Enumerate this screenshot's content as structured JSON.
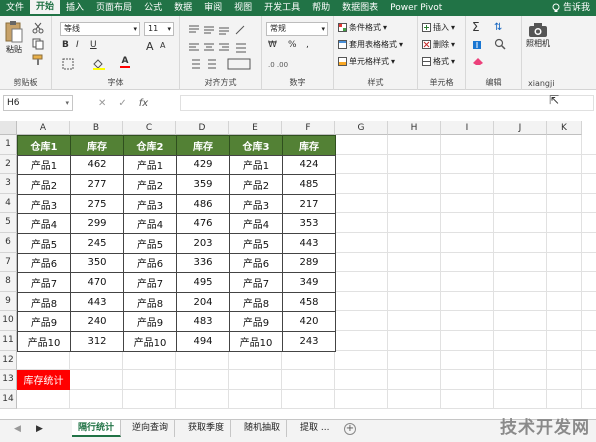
{
  "tabs": [
    "文件",
    "开始",
    "插入",
    "页面布局",
    "公式",
    "数据",
    "审阅",
    "视图",
    "开发工具",
    "帮助",
    "数据图表",
    "Power Pivot"
  ],
  "active_tab": "开始",
  "tell_me": "告诉我",
  "ribbon": {
    "clipboard": {
      "paste": "粘贴",
      "label": "剪贴板"
    },
    "font": {
      "name": "等线",
      "size": "11",
      "label": "字体",
      "bold": "B",
      "italic": "I",
      "underline": "U",
      "grow": "A",
      "shrink": "A",
      "color_glyph": "A"
    },
    "align": {
      "label": "对齐方式"
    },
    "number": {
      "format": "常规",
      "label": "数字",
      "percent": "%",
      "comma": ",",
      "currency": "₩"
    },
    "styles": {
      "cond": "条件格式",
      "table": "套用表格格式",
      "cell": "单元格样式",
      "label": "样式"
    },
    "cells": {
      "insert": "插入",
      "delete": "删除",
      "format": "格式",
      "label": "单元格"
    },
    "edit": {
      "label": "编辑"
    },
    "camera": {
      "label": "照相机",
      "group": "xiangji"
    }
  },
  "formula_bar": {
    "name_box": "H6",
    "cancel": "✕",
    "enter": "✓",
    "fx": "fx",
    "content": ""
  },
  "columns": [
    "A",
    "B",
    "C",
    "D",
    "E",
    "F",
    "G",
    "H",
    "I",
    "J",
    "K"
  ],
  "rows": [
    "1",
    "2",
    "3",
    "4",
    "5",
    "6",
    "7",
    "8",
    "9",
    "10",
    "11",
    "12",
    "13",
    "14"
  ],
  "table": {
    "headers": [
      "仓库1",
      "库存",
      "仓库2",
      "库存",
      "仓库3",
      "库存"
    ],
    "rows": [
      [
        "产品1",
        "462",
        "产品1",
        "429",
        "产品1",
        "424"
      ],
      [
        "产品2",
        "277",
        "产品2",
        "359",
        "产品2",
        "485"
      ],
      [
        "产品3",
        "275",
        "产品3",
        "486",
        "产品3",
        "217"
      ],
      [
        "产品4",
        "299",
        "产品4",
        "476",
        "产品4",
        "353"
      ],
      [
        "产品5",
        "245",
        "产品5",
        "203",
        "产品5",
        "443"
      ],
      [
        "产品6",
        "350",
        "产品6",
        "336",
        "产品6",
        "289"
      ],
      [
        "产品7",
        "470",
        "产品7",
        "495",
        "产品7",
        "349"
      ],
      [
        "产品8",
        "443",
        "产品8",
        "204",
        "产品8",
        "458"
      ],
      [
        "产品9",
        "240",
        "产品9",
        "483",
        "产品9",
        "420"
      ],
      [
        "产品10",
        "312",
        "产品10",
        "494",
        "产品10",
        "243"
      ]
    ]
  },
  "stat_label": "库存统计",
  "sheet_tabs": [
    "隔行统计",
    "逆向查询",
    "获取季度",
    "随机抽取",
    "提取 ..."
  ],
  "active_sheet": "隔行统计",
  "add_sheet": "+",
  "watermark": "技术开发网",
  "colors": {
    "accent": "#217346",
    "table_header": "#538135",
    "stat": "#ff0000"
  }
}
